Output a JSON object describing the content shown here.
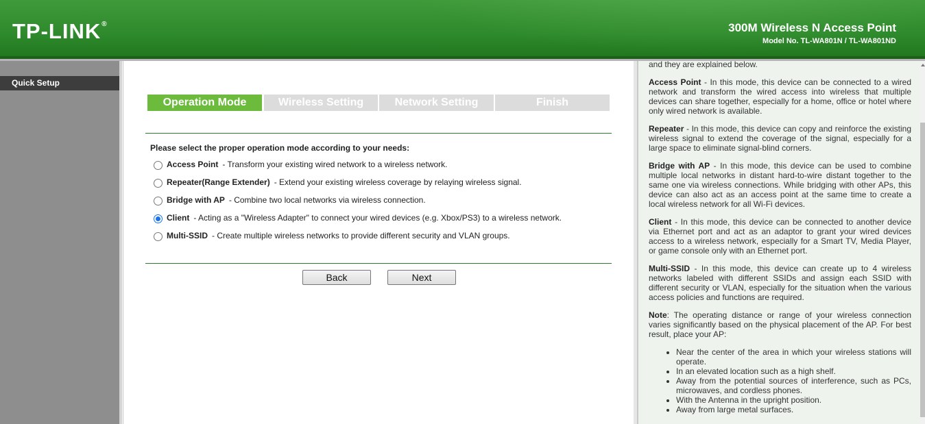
{
  "header": {
    "logo": "TP-LINK",
    "product_title": "300M Wireless N Access Point",
    "model": "Model No. TL-WA801N / TL-WA801ND"
  },
  "menu": {
    "items": [
      {
        "label": "Quick Setup",
        "selected": true
      }
    ]
  },
  "wizard": {
    "steps": [
      {
        "label": "Operation Mode",
        "active": true
      },
      {
        "label": "Wireless Setting",
        "active": false
      },
      {
        "label": "Network Setting",
        "active": false
      },
      {
        "label": "Finish",
        "active": false
      }
    ],
    "prompt": "Please select the proper operation mode according to your needs:",
    "options": [
      {
        "name": "Access Point",
        "desc": "- Transform your existing wired network to a wireless network.",
        "checked": false
      },
      {
        "name": "Repeater(Range Extender)",
        "desc": "- Extend your existing wireless coverage by relaying wireless signal.",
        "checked": false
      },
      {
        "name": "Bridge with AP",
        "desc": "- Combine two local networks via wireless connection.",
        "checked": false
      },
      {
        "name": "Client",
        "desc": "- Acting as a \"Wireless Adapter\" to connect your wired devices (e.g. Xbox/PS3) to a wireless network.",
        "checked": true
      },
      {
        "name": "Multi-SSID",
        "desc": "- Create multiple wireless networks to provide different security and VLAN groups.",
        "checked": false
      }
    ],
    "back_label": "Back",
    "next_label": "Next"
  },
  "help": {
    "intro": "and they are explained below.",
    "sections": [
      {
        "title": "Access Point",
        "text": " - In this mode, this device can be connected to a wired network and transform the wired access into wireless that multiple devices can share together, especially for a home, office or hotel where only wired network is available."
      },
      {
        "title": "Repeater",
        "text": " - In this mode, this device can copy and reinforce the existing wireless signal to extend the coverage of the signal, especially for a large space to eliminate signal-blind corners."
      },
      {
        "title": "Bridge with AP",
        "text": " - In this mode, this device can be used to combine multiple local networks in distant hard-to-wire distant together to the same one via wireless connections. While bridging with other APs, this device can also act as an access point at the same time to create a local wireless network for all Wi-Fi devices."
      },
      {
        "title": "Client",
        "text": " - In this mode, this device can be connected to another device via Ethernet port and act as an adaptor to grant your wired devices access to a wireless network, especially for a Smart TV, Media Player, or game console only with an Ethernet port."
      },
      {
        "title": "Multi-SSID",
        "text": " - In this mode, this device can create up to 4 wireless networks labeled with different SSIDs and assign each SSID with different security or VLAN, especially for the situation when the various access policies and functions are required."
      },
      {
        "title": "Note",
        "text": ": The operating distance or range of your wireless connection varies significantly based on the physical placement of the AP. For best result, place your AP:"
      }
    ],
    "bullets": [
      "Near the center of the area in which your wireless stations will operate.",
      "In an elevated location such as a high shelf.",
      "Away from the potential sources of interference, such as PCs, microwaves, and cordless phones.",
      "With the Antenna in the upright position.",
      "Away from large metal surfaces."
    ]
  },
  "colors": {
    "header_green": "#2e8a2c",
    "step_active": "#6cbb3c",
    "step_inactive": "#dcdcdc",
    "menu_selected": "#3d3d3d",
    "help_bg": "#eef3ee"
  }
}
